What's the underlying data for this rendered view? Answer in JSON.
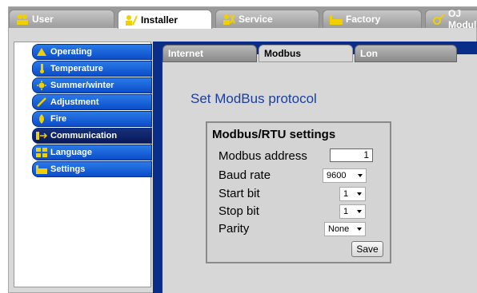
{
  "top_tabs": [
    {
      "label": "User",
      "icon": "user-group-icon"
    },
    {
      "label": "Installer",
      "icon": "installer-icon"
    },
    {
      "label": "Service",
      "icon": "service-icon"
    },
    {
      "label": "Factory",
      "icon": "factory-icon"
    },
    {
      "label": "OJ Modul",
      "icon": "oj-module-icon"
    }
  ],
  "active_top_tab": "Installer",
  "sidebar": {
    "items": [
      {
        "label": "Operating",
        "icon": "operating-icon"
      },
      {
        "label": "Temperature",
        "icon": "thermometer-icon"
      },
      {
        "label": "Summer/winter",
        "icon": "sun-icon"
      },
      {
        "label": "Adjustment",
        "icon": "adjustment-icon"
      },
      {
        "label": "Fire",
        "icon": "fire-icon"
      },
      {
        "label": "Communication",
        "icon": "communication-icon"
      },
      {
        "label": "Language",
        "icon": "language-icon"
      },
      {
        "label": "Settings",
        "icon": "settings-icon"
      }
    ],
    "active": "Communication"
  },
  "sub_tabs": [
    "Internet",
    "Modbus",
    "Lon"
  ],
  "active_sub_tab": "Modbus",
  "main": {
    "heading": "Set ModBus protocol",
    "box_title": "Modbus/RTU settings",
    "fields": {
      "address_label": "Modbus address",
      "address_value": "1",
      "baud_label": "Baud rate",
      "baud_value": "9600",
      "start_label": "Start bit",
      "start_value": "1",
      "stop_label": "Stop bit",
      "stop_value": "1",
      "parity_label": "Parity",
      "parity_value": "None"
    },
    "save_label": "Save"
  },
  "colors": {
    "nav_blue": "#0b4dc9",
    "nav_active": "#08195a",
    "panel_dark_blue": "#0b2d8a",
    "heading_blue": "#1c3f9e",
    "icon_yellow": "#f0d000"
  }
}
